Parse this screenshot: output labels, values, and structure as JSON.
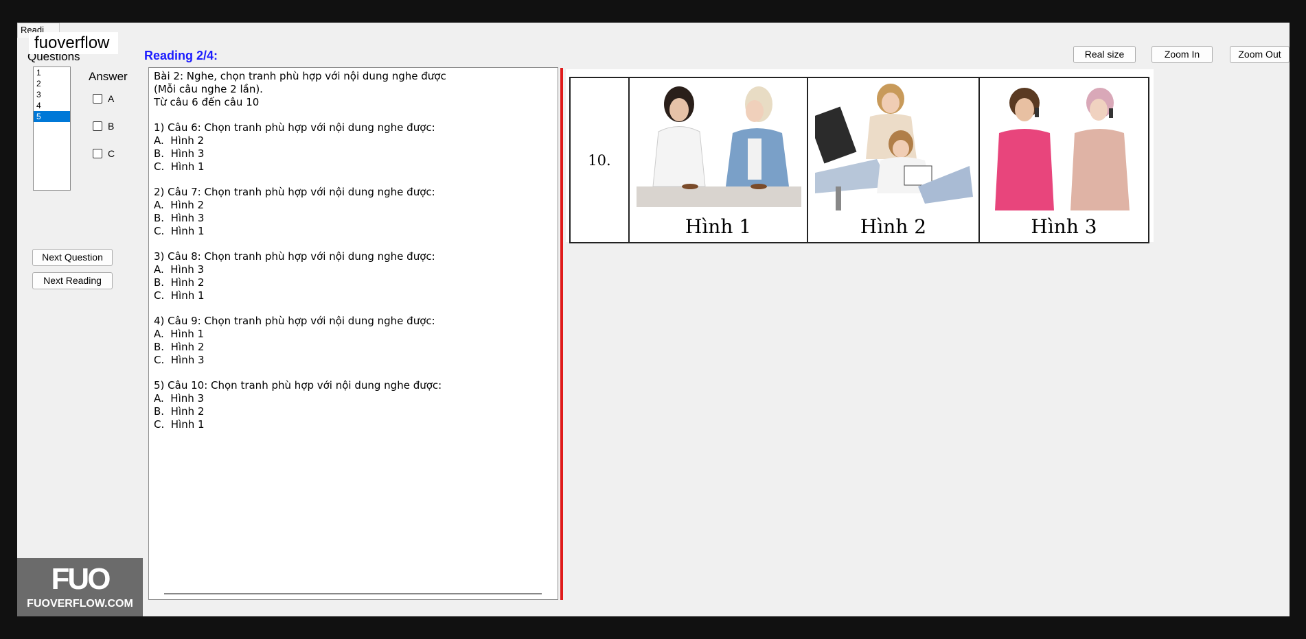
{
  "watermark": "fuoverflow",
  "tab_stub": "Readi",
  "questions_label": "Questions",
  "reading_title": "Reading 2/4:",
  "question_list": [
    "1",
    "2",
    "3",
    "4",
    "5"
  ],
  "selected_question": "5",
  "answer_label": "Answer",
  "answer_options": [
    "A",
    "B",
    "C"
  ],
  "buttons": {
    "next_question": "Next Question",
    "next_reading": "Next Reading",
    "real_size": "Real size",
    "zoom_in": "Zoom In",
    "zoom_out": "Zoom Out"
  },
  "text_lines": [
    "Bài 2: Nghe, chọn tranh phù hợp với nội dung nghe được",
    "(Mỗi câu nghe 2 lần).",
    "Từ câu 6 đến câu 10",
    "",
    "1) Câu 6: Chọn tranh phù hợp với nội dung nghe được:",
    "A.  Hình 2",
    "B.  Hình 3",
    "C.  Hình 1",
    "",
    "2) Câu 7: Chọn tranh phù hợp với nội dung nghe được:",
    "A.  Hình 2",
    "B.  Hình 3",
    "C.  Hình 1",
    "",
    "3) Câu 8: Chọn tranh phù hợp với nội dung nghe được:",
    "A.  Hình 3",
    "B.  Hình 2",
    "C.  Hình 1",
    "",
    "4) Câu 9: Chọn tranh phù hợp với nội dung nghe được:",
    "A.  Hình 1",
    "B.  Hình 2",
    "C.  Hình 3",
    "",
    "5) Câu 10: Chọn tranh phù hợp với nội dung nghe được:",
    "A.  Hình 3",
    "B.  Hình 2",
    "C.  Hình 1"
  ],
  "image_table": {
    "number": "10.",
    "captions": [
      "Hình 1",
      "Hình 2",
      "Hình 3"
    ]
  },
  "logo": {
    "mark": "FUO",
    "site": "FUOVERFLOW.COM"
  },
  "colors": {
    "accent_blue": "#1a1aff",
    "selection": "#0078d7",
    "divider_red": "#e01b1b"
  }
}
